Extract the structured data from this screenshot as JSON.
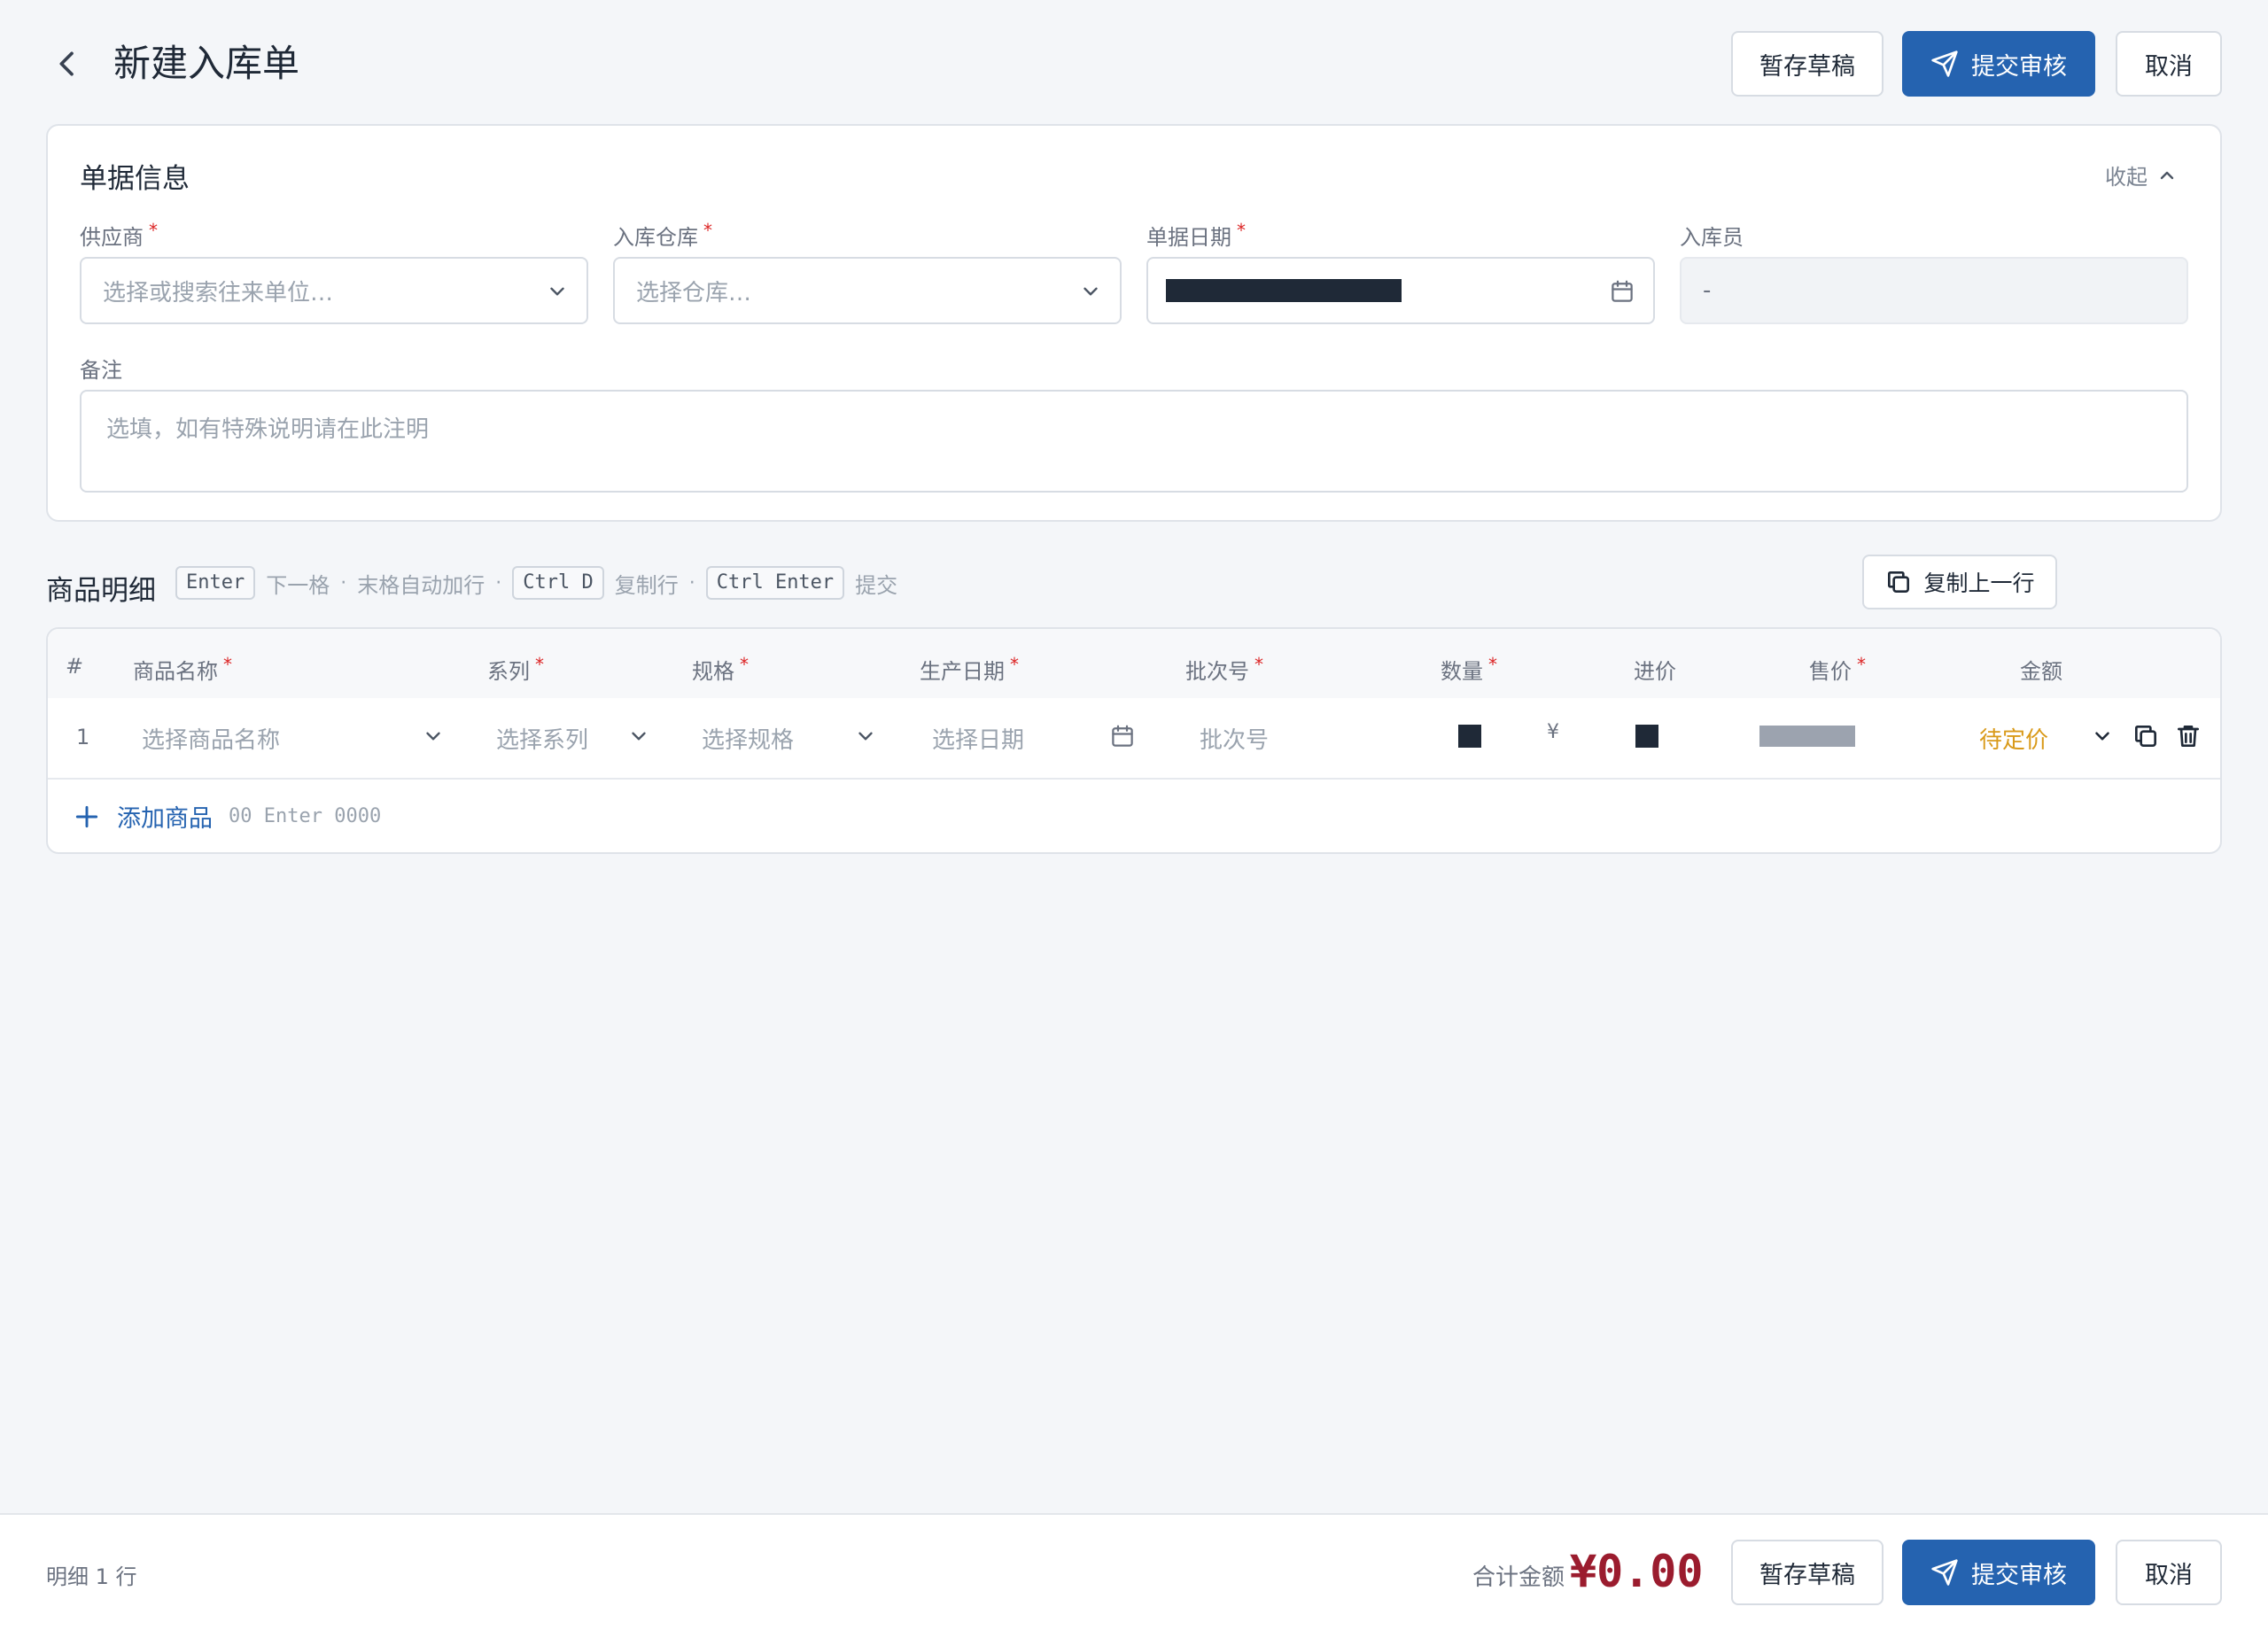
{
  "header": {
    "title": "新建入库单",
    "save_draft": "暂存草稿",
    "submit": "提交审核",
    "cancel": "取消"
  },
  "doc_info": {
    "title": "单据信息",
    "collapse_label": "收起",
    "supplier": {
      "label": "供应商",
      "placeholder": "选择或搜索往来单位…"
    },
    "warehouse": {
      "label": "入库仓库",
      "placeholder": "选择仓库…"
    },
    "date": {
      "label": "单据日期"
    },
    "operator": {
      "label": "入库员",
      "value": "-"
    },
    "note": {
      "label": "备注",
      "placeholder": "选填，如有特殊说明请在此注明"
    },
    "required_mark": "*"
  },
  "detail": {
    "title": "商品明细",
    "shortcuts": [
      {
        "key": "Enter",
        "desc": "下一格"
      },
      {
        "key": "",
        "desc": "末格自动加行"
      },
      {
        "key": "Ctrl D",
        "desc": "复制行"
      },
      {
        "key": "Ctrl Enter",
        "desc": "提交"
      }
    ],
    "separator": "·",
    "copy_prev_row": "复制上一行",
    "columns": [
      "#",
      "商品名称",
      "系列",
      "规格",
      "生产日期",
      "批次号",
      "数量",
      "进价",
      "售价",
      "金额"
    ],
    "rows": [
      {
        "index": "1",
        "product_placeholder": "选择商品名称",
        "series_placeholder": "选择系列",
        "spec_placeholder": "选择规格",
        "date_placeholder": "选择日期",
        "batch_placeholder": "批次号",
        "currency": "¥",
        "amount": "待定价"
      }
    ],
    "add_item": "添加商品",
    "add_hint": "00 Enter 0000"
  },
  "footer": {
    "row_count": "明细 1 行",
    "total_label": "合计金额",
    "total_value": "¥0.00",
    "save_draft": "暂存草稿",
    "submit": "提交审核",
    "cancel": "取消"
  },
  "colors": {
    "primary": "#2563b0",
    "required": "#dc2626",
    "pending_price": "#d99a1a",
    "total": "#9b1c2e"
  }
}
